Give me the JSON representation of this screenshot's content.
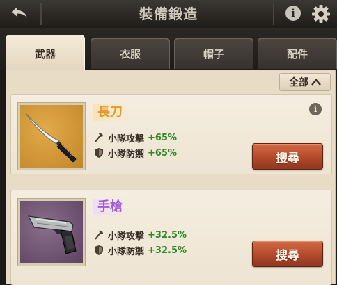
{
  "header": {
    "title": "裝備鍛造",
    "back_icon": "back-arrow-icon",
    "info_icon": "info-icon",
    "settings_icon": "gear-icon"
  },
  "tabs": [
    {
      "label": "武器",
      "active": true
    },
    {
      "label": "衣服",
      "active": false
    },
    {
      "label": "帽子",
      "active": false
    },
    {
      "label": "配件",
      "active": false
    }
  ],
  "filter": {
    "label": "全部",
    "icon": "chevron-up-icon"
  },
  "items": [
    {
      "name": "長刀",
      "icon": "katana-icon",
      "rarity_color": "#e49a25",
      "stats": [
        {
          "icon": "axe-icon",
          "label": "小隊攻擊",
          "value": "+65%"
        },
        {
          "icon": "shield-icon",
          "label": "小隊防禦",
          "value": "+65%"
        }
      ],
      "button": "搜尋"
    },
    {
      "name": "手槍",
      "icon": "pistol-icon",
      "rarity_color": "#a05bd6",
      "stats": [
        {
          "icon": "axe-icon",
          "label": "小隊攻擊",
          "value": "+32.5%"
        },
        {
          "icon": "shield-icon",
          "label": "小隊防禦",
          "value": "+32.5%"
        }
      ],
      "button": "搜尋"
    }
  ],
  "colors": {
    "stat_value": "#2f8a23",
    "search_button": "#b24a2b",
    "panel": "#e8dcc6"
  }
}
